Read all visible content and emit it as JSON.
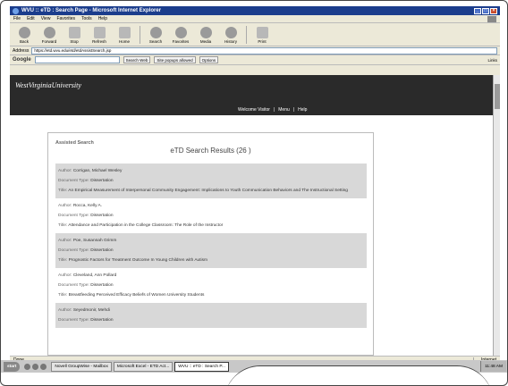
{
  "window": {
    "title": "WVU :: eTD : Search Page - Microsoft Internet Explorer"
  },
  "menu": [
    "File",
    "Edit",
    "View",
    "Favorites",
    "Tools",
    "Help"
  ],
  "toolbar": [
    "Back",
    "Forward",
    "Stop",
    "Refresh",
    "Home",
    "Search",
    "Favorites",
    "Media",
    "History",
    "Print"
  ],
  "address": {
    "label": "Address",
    "url": "https://etd.wvu.edu/etd/etdAssistSearch.jsp"
  },
  "google": {
    "logo": "Google",
    "search_web": "Search Web",
    "popups": "Site popups allowed",
    "options": "Options",
    "links": "Links"
  },
  "site": {
    "brand": "WestVirginiaUniversity",
    "welcome": "Welcome Visitor",
    "menu": "Menu",
    "help": "Help"
  },
  "page": {
    "assisted": "Assisted Search",
    "results_title": "eTD Search Results (26 )"
  },
  "labels": {
    "author": "Author:",
    "doctype": "Document Type:",
    "title": "Title:"
  },
  "results": [
    {
      "author": "Corrigan, Michael Wesley",
      "type": "Dissertation",
      "title": "An Empirical Measurement of Interpersonal Community Engagement: Implications to Youth Communication Behaviors and The Instructional Setting"
    },
    {
      "author": "Rocca, Kelly A.",
      "type": "Dissertation",
      "title": "Attendance and Participation in the College Classroom: The Role of the Instructor"
    },
    {
      "author": "Poe, Susannah Grimm",
      "type": "Dissertation",
      "title": "Prognostic Factors for Treatment Outcome In Young Children with Autism"
    },
    {
      "author": "Cleveland, Ann Pollard",
      "type": "Dissertation",
      "title": "Breastfeeding Perceived Efficacy Beliefs of Women University Students"
    },
    {
      "author": "Seyedmonir, Mehdi",
      "type": "Dissertation",
      "title": ""
    }
  ],
  "status": {
    "left": "Done",
    "zone": "Internet"
  },
  "taskbar": {
    "start": "start",
    "tasks": [
      "Novell GroupWise - Mailbox",
      "Microsoft Excel - ETD Act...",
      "WVU :: eTD : Search P..."
    ],
    "clock": "11:48 AM"
  }
}
